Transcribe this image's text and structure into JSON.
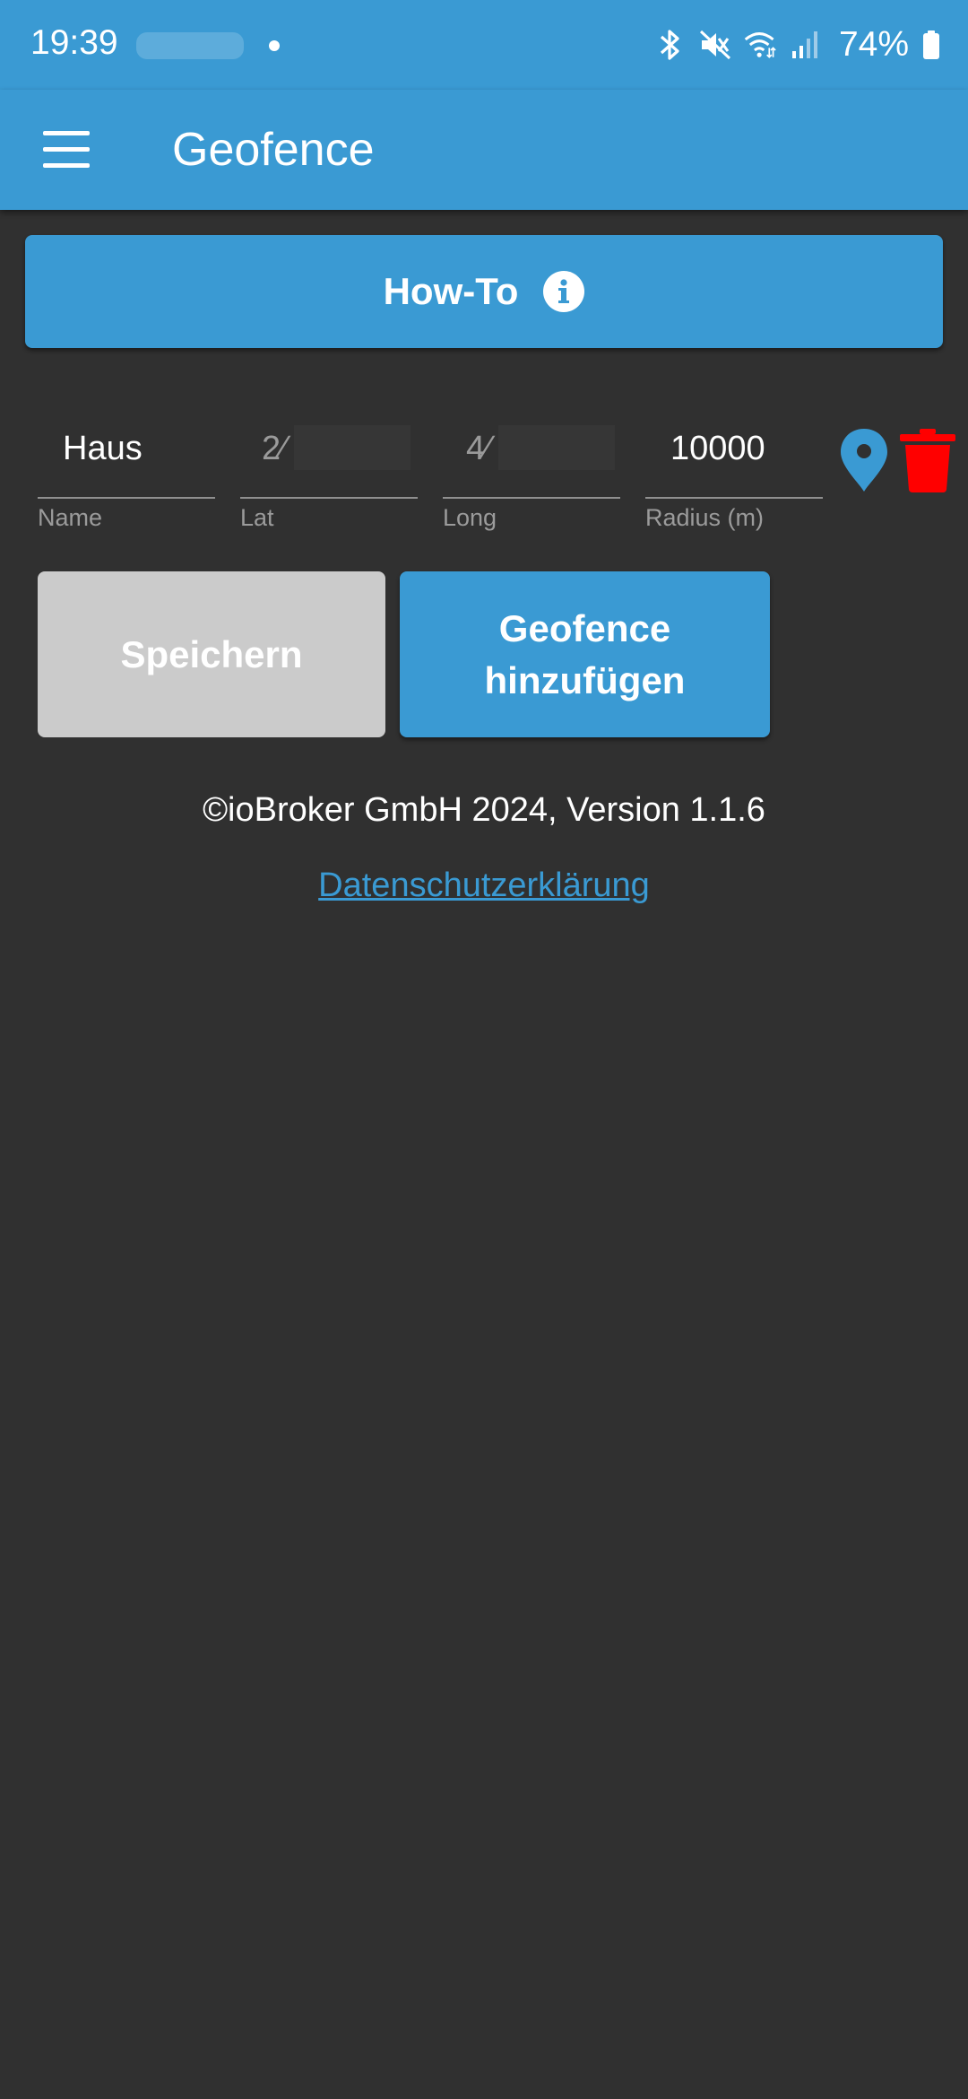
{
  "status_bar": {
    "time": "19:39",
    "battery_percent": "74%",
    "icons": [
      "bluetooth-icon",
      "mute-icon",
      "wifi-icon",
      "signal-icon",
      "battery-icon"
    ]
  },
  "app_bar": {
    "title": "Geofence",
    "menu_icon": "menu-icon"
  },
  "howto_button": {
    "label": "How-To",
    "icon": "info-icon"
  },
  "geofence_entry": {
    "name": {
      "value": "Haus",
      "label": "Name"
    },
    "lat": {
      "value": "2⁄",
      "label": "Lat"
    },
    "long": {
      "value": "4⁄",
      "label": "Long"
    },
    "radius": {
      "value": "10000",
      "label": "Radius (m)"
    }
  },
  "actions": {
    "save_label": "Speichern",
    "add_label": "Geofence hinzufügen"
  },
  "footer": {
    "copyright": "©ioBroker GmbH 2024, Version 1.1.6",
    "privacy_link": "Datenschutzerklärung"
  },
  "colors": {
    "primary": "#3a9ad3",
    "background": "#303030",
    "delete": "#ff0000",
    "disabled_button": "#cbcbcb"
  }
}
